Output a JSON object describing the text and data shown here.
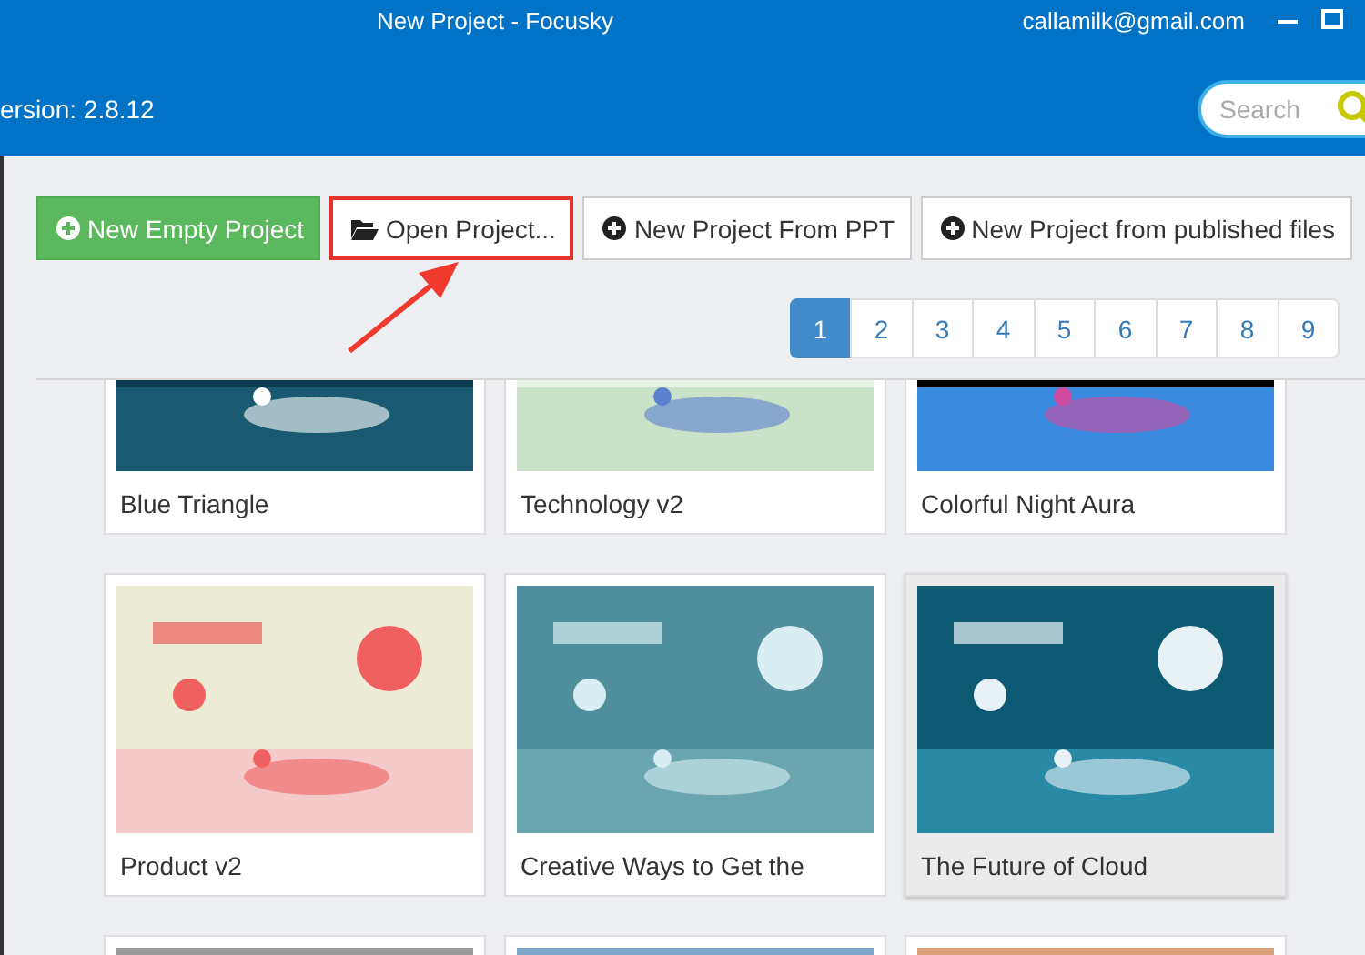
{
  "window": {
    "title": "New Project - Focusky",
    "account": "callamilk@gmail.com"
  },
  "header": {
    "version": "ersion: 2.8.12",
    "search": {
      "placeholder": "Search"
    }
  },
  "actions": [
    {
      "label": "New Empty Project",
      "kind": "primary",
      "highlighted": false
    },
    {
      "label": "Open Project...",
      "kind": "open",
      "highlighted": true
    },
    {
      "label": "New Project From PPT",
      "kind": "create",
      "highlighted": false
    },
    {
      "label": "New Project from published files",
      "kind": "create",
      "highlighted": false
    }
  ],
  "pagination": [
    {
      "label": "1",
      "selected": true
    },
    {
      "label": "2",
      "selected": false
    },
    {
      "label": "3",
      "selected": false
    },
    {
      "label": "4",
      "selected": false
    },
    {
      "label": "5",
      "selected": false
    },
    {
      "label": "6",
      "selected": false
    },
    {
      "label": "7",
      "selected": false
    },
    {
      "label": "8",
      "selected": false
    },
    {
      "label": "9",
      "selected": false
    }
  ],
  "templates": [
    {
      "title": "Blue Triangle",
      "selected": false
    },
    {
      "title": "Technology v2",
      "selected": false
    },
    {
      "title": "Colorful Night Aura",
      "selected": false
    },
    {
      "title": "Product v2",
      "selected": false
    },
    {
      "title": "Creative Ways to Get the",
      "selected": false
    },
    {
      "title": "The Future of Cloud",
      "selected": true
    },
    {
      "selected": false
    },
    {
      "selected": false
    },
    {
      "selected": false
    }
  ]
}
